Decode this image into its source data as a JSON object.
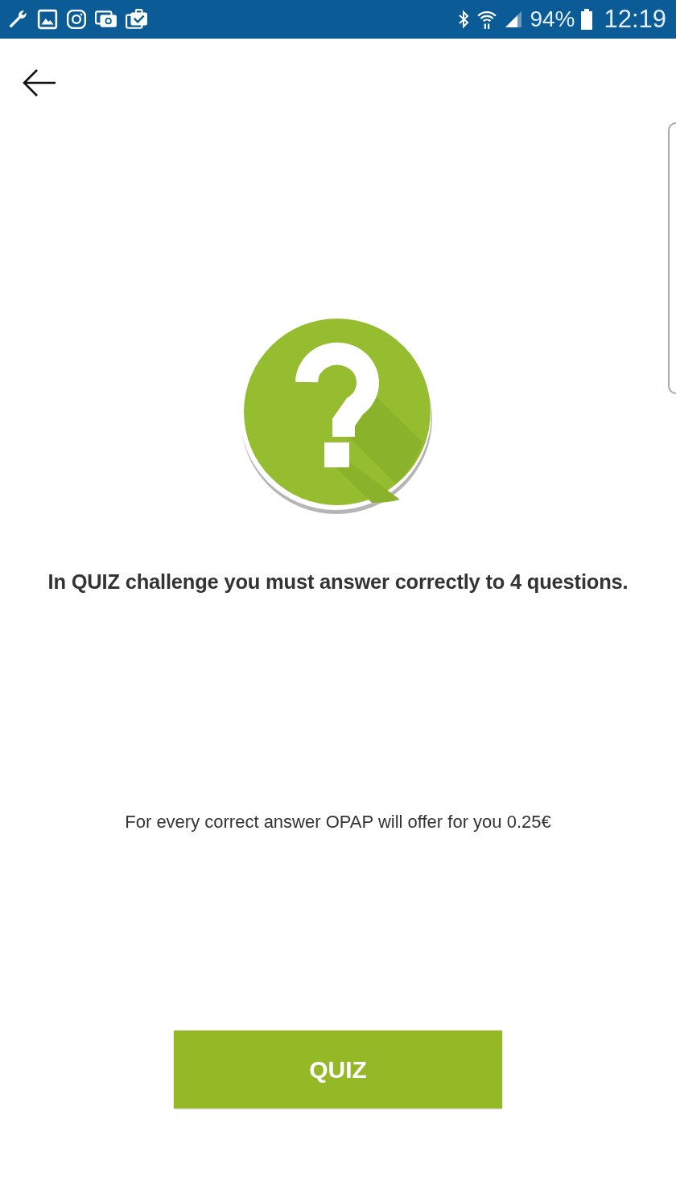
{
  "status_bar": {
    "battery": "94%",
    "time": "12:19"
  },
  "intro": "In QUIZ challenge you must answer correctly to 4 questions.",
  "reward_note": "For every correct answer OPAP will offer for you 0.25€",
  "button": {
    "label": "QUIZ"
  }
}
